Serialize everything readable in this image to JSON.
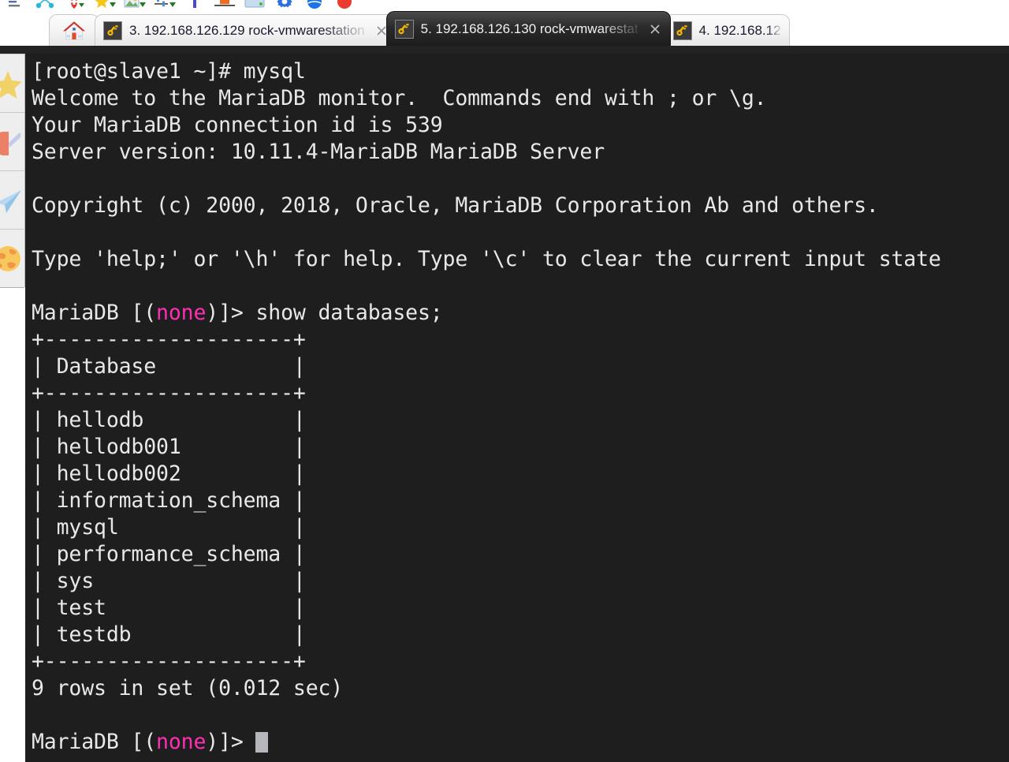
{
  "toolbar": {
    "icons": [
      {
        "name": "align-icon",
        "color": "#5b6bbf"
      },
      {
        "name": "network-nodes-icon",
        "color": "#29b6d8"
      },
      {
        "name": "shield-add-icon",
        "color": "#e03b2e"
      },
      {
        "name": "star-dropdown-icon",
        "color": "#f5c518"
      },
      {
        "name": "image-dropdown-icon",
        "color": "#3f8f3f"
      },
      {
        "name": "settings-slider-icon",
        "color": "#2f7f3f"
      },
      {
        "name": "bookmark-bar-icon",
        "color": "#4b4bc8"
      },
      {
        "name": "split-orange-icon",
        "color": "#f26a1b"
      },
      {
        "name": "window-icon",
        "color": "#b9cfe8"
      },
      {
        "name": "gear-icon",
        "color": "#2b6fe0"
      },
      {
        "name": "globe-blue-icon",
        "color": "#1a73e8"
      },
      {
        "name": "record-red-icon",
        "color": "#ea3b2e"
      }
    ]
  },
  "tabs": {
    "home_label": "",
    "items": [
      {
        "label": "3. 192.168.126.129 rock-vmwarestation",
        "active": false,
        "closable": true
      },
      {
        "label": "5. 192.168.126.130 rock-vmwarestat",
        "active": true,
        "closable": true
      },
      {
        "label": "4. 192.168.12",
        "active": false,
        "closable": false
      }
    ]
  },
  "sidebar": {
    "items": [
      {
        "name": "sidebar-item-favorites",
        "icon": "star-icon"
      },
      {
        "name": "sidebar-item-tools",
        "icon": "swiss-army-knife-icon"
      },
      {
        "name": "sidebar-item-send",
        "icon": "paper-plane-icon"
      },
      {
        "name": "sidebar-item-globe",
        "icon": "globe-icon"
      }
    ]
  },
  "terminal": {
    "colors": {
      "background": "#1e1e1e",
      "foreground": "#e8e8e8",
      "magenta": "#ff2fb4",
      "cursor": "#b6b6bd"
    },
    "lines": [
      {
        "segments": [
          {
            "text": "[root@slave1 ~]# mysql"
          }
        ]
      },
      {
        "segments": [
          {
            "text": "Welcome to the MariaDB monitor.  Commands end with ; or \\g."
          }
        ]
      },
      {
        "segments": [
          {
            "text": "Your MariaDB connection id is 539"
          }
        ]
      },
      {
        "segments": [
          {
            "text": "Server version: 10.11.4-MariaDB MariaDB Server"
          }
        ]
      },
      {
        "segments": [
          {
            "text": ""
          }
        ]
      },
      {
        "segments": [
          {
            "text": "Copyright (c) 2000, 2018, Oracle, MariaDB Corporation Ab and others."
          }
        ]
      },
      {
        "segments": [
          {
            "text": ""
          }
        ]
      },
      {
        "segments": [
          {
            "text": "Type 'help;' or '\\h' for help. Type '\\c' to clear the current input state"
          }
        ]
      },
      {
        "segments": [
          {
            "text": ""
          }
        ]
      },
      {
        "segments": [
          {
            "text": "MariaDB [("
          },
          {
            "text": "none",
            "color": "magenta"
          },
          {
            "text": ")]> show databases;"
          }
        ]
      },
      {
        "segments": [
          {
            "text": "+--------------------+"
          }
        ]
      },
      {
        "segments": [
          {
            "text": "| Database           |"
          }
        ]
      },
      {
        "segments": [
          {
            "text": "+--------------------+"
          }
        ]
      },
      {
        "segments": [
          {
            "text": "| hellodb            |"
          }
        ]
      },
      {
        "segments": [
          {
            "text": "| hellodb001         |"
          }
        ]
      },
      {
        "segments": [
          {
            "text": "| hellodb002         |"
          }
        ]
      },
      {
        "segments": [
          {
            "text": "| information_schema |"
          }
        ]
      },
      {
        "segments": [
          {
            "text": "| mysql              |"
          }
        ]
      },
      {
        "segments": [
          {
            "text": "| performance_schema |"
          }
        ]
      },
      {
        "segments": [
          {
            "text": "| sys                |"
          }
        ]
      },
      {
        "segments": [
          {
            "text": "| test               |"
          }
        ]
      },
      {
        "segments": [
          {
            "text": "| testdb             |"
          }
        ]
      },
      {
        "segments": [
          {
            "text": "+--------------------+"
          }
        ]
      },
      {
        "segments": [
          {
            "text": "9 rows in set (0.012 sec)"
          }
        ]
      },
      {
        "segments": [
          {
            "text": ""
          }
        ]
      },
      {
        "segments": [
          {
            "text": "MariaDB [("
          },
          {
            "text": "none",
            "color": "magenta"
          },
          {
            "text": ")]> "
          },
          {
            "cursor": true
          }
        ]
      }
    ],
    "query": "show databases;",
    "result_columns": [
      "Database"
    ],
    "result_rows": [
      "hellodb",
      "hellodb001",
      "hellodb002",
      "information_schema",
      "mysql",
      "performance_schema",
      "sys",
      "test",
      "testdb"
    ],
    "row_count_text": "9 rows in set (0.012 sec)",
    "prompt": "MariaDB [(none)]>",
    "server_version": "10.11.4-MariaDB MariaDB Server",
    "connection_id": "539",
    "host_prompt": "[root@slave1 ~]#",
    "command": "mysql"
  }
}
